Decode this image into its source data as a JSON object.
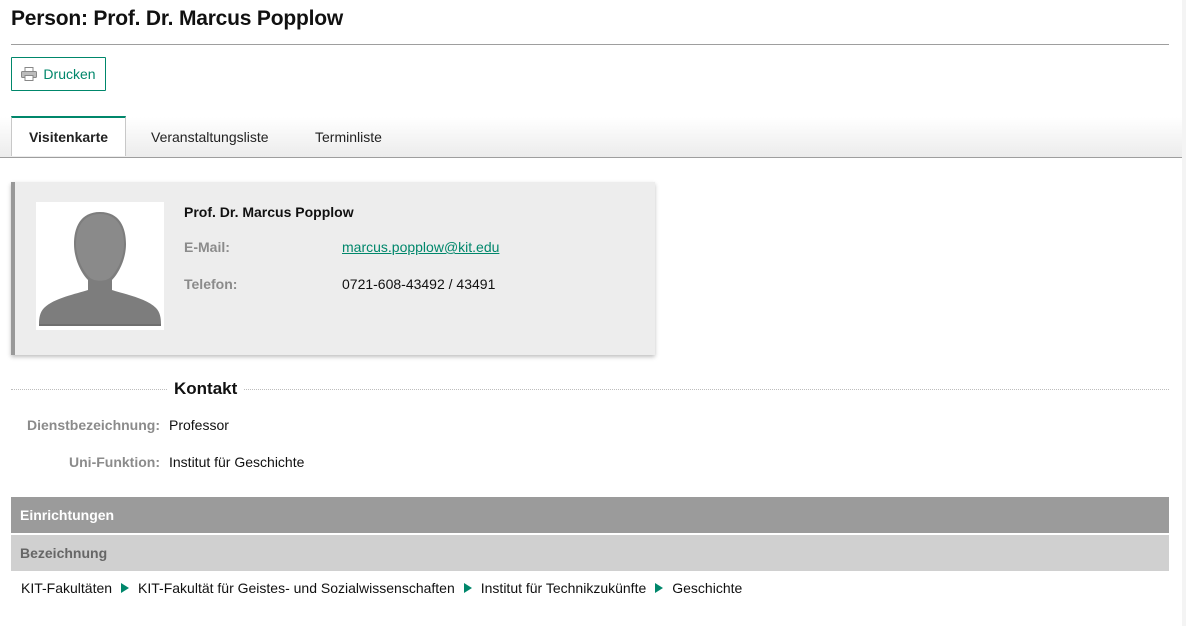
{
  "page": {
    "title": "Person: Prof. Dr. Marcus Popplow"
  },
  "toolbar": {
    "print_label": "Drucken",
    "print_icon": "printer-icon"
  },
  "tabs": [
    {
      "label": "Visitenkarte",
      "active": true
    },
    {
      "label": "Veranstaltungsliste",
      "active": false
    },
    {
      "label": "Terminliste",
      "active": false
    }
  ],
  "card": {
    "name": "Prof. Dr. Marcus Popplow",
    "email_label": "E-Mail:",
    "email": "marcus.popplow@kit.edu",
    "phone_label": "Telefon:",
    "phone": "0721-608-43492 / 43491",
    "avatar_icon": "person-silhouette-icon"
  },
  "contact": {
    "title": "Kontakt",
    "fields": [
      {
        "label": "Dienstbezeichnung:",
        "value": "Professor"
      },
      {
        "label": "Uni-Funktion:",
        "value": "Institut für Geschichte"
      }
    ]
  },
  "institutions": {
    "header": "Einrichtungen",
    "column": "Bezeichnung",
    "path": [
      "KIT-Fakultäten",
      "KIT-Fakultät für Geistes- und Sozialwissenschaften",
      "Institut für Technikzukünfte",
      "Geschichte"
    ]
  },
  "colors": {
    "accent": "#00876b",
    "bar_dark": "#9b9b9b",
    "bar_light": "#d0d0d0",
    "card_bg": "#ededed"
  }
}
